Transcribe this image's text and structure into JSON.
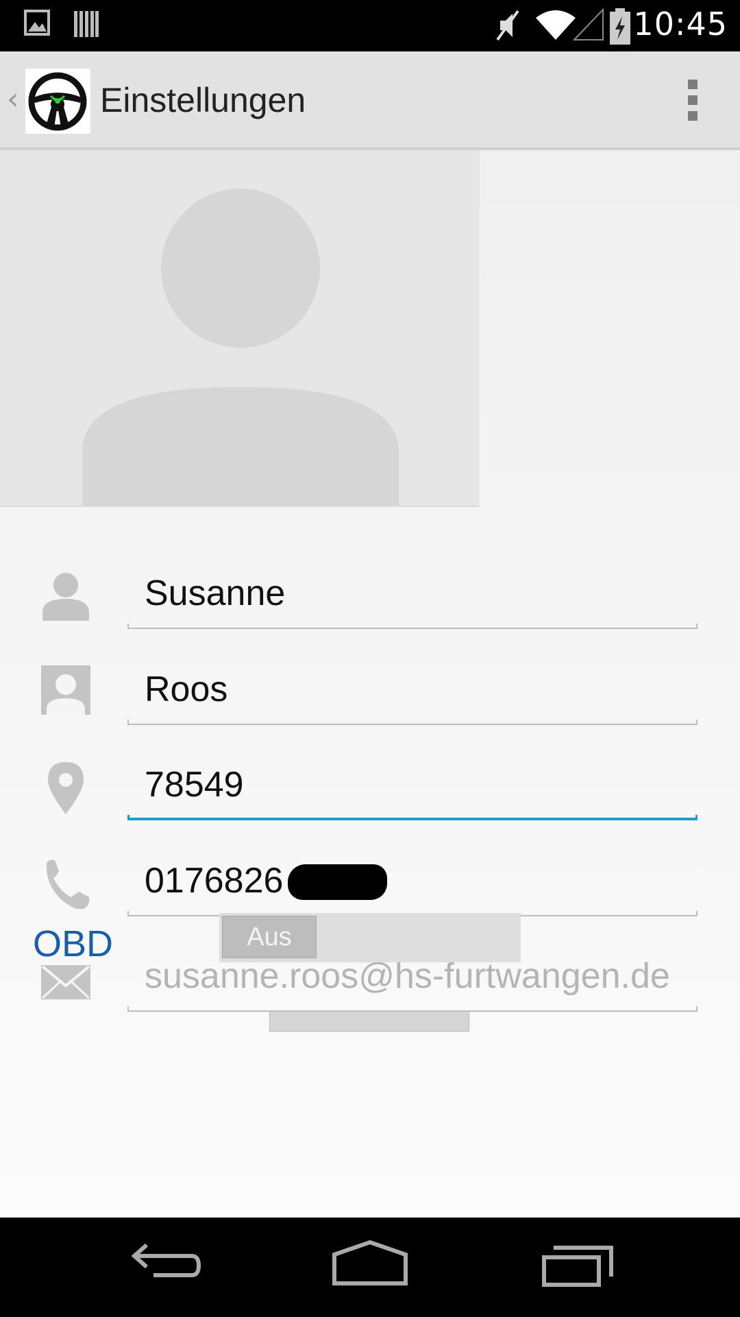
{
  "status_bar": {
    "time": "10:45",
    "icons": [
      "image-notification-icon",
      "barcode-notification-icon",
      "muted-icon",
      "wifi-icon",
      "signal-icon",
      "battery-charging-icon"
    ]
  },
  "action_bar": {
    "title": "Einstellungen",
    "logo": "steering-wheel-logo",
    "colors": {
      "logo_accent": "#2bd12b"
    }
  },
  "profile": {
    "first_name": "Susanne",
    "last_name": "Roos",
    "postal_code": "78549",
    "phone": "0176826",
    "email": "susanne.roos@hs-furtwangen.de"
  },
  "obd": {
    "label": "OBD",
    "toggle_state": "Aus"
  },
  "colors": {
    "focus_underline": "#1e9bd3",
    "obd_label": "#1a5fa8"
  }
}
